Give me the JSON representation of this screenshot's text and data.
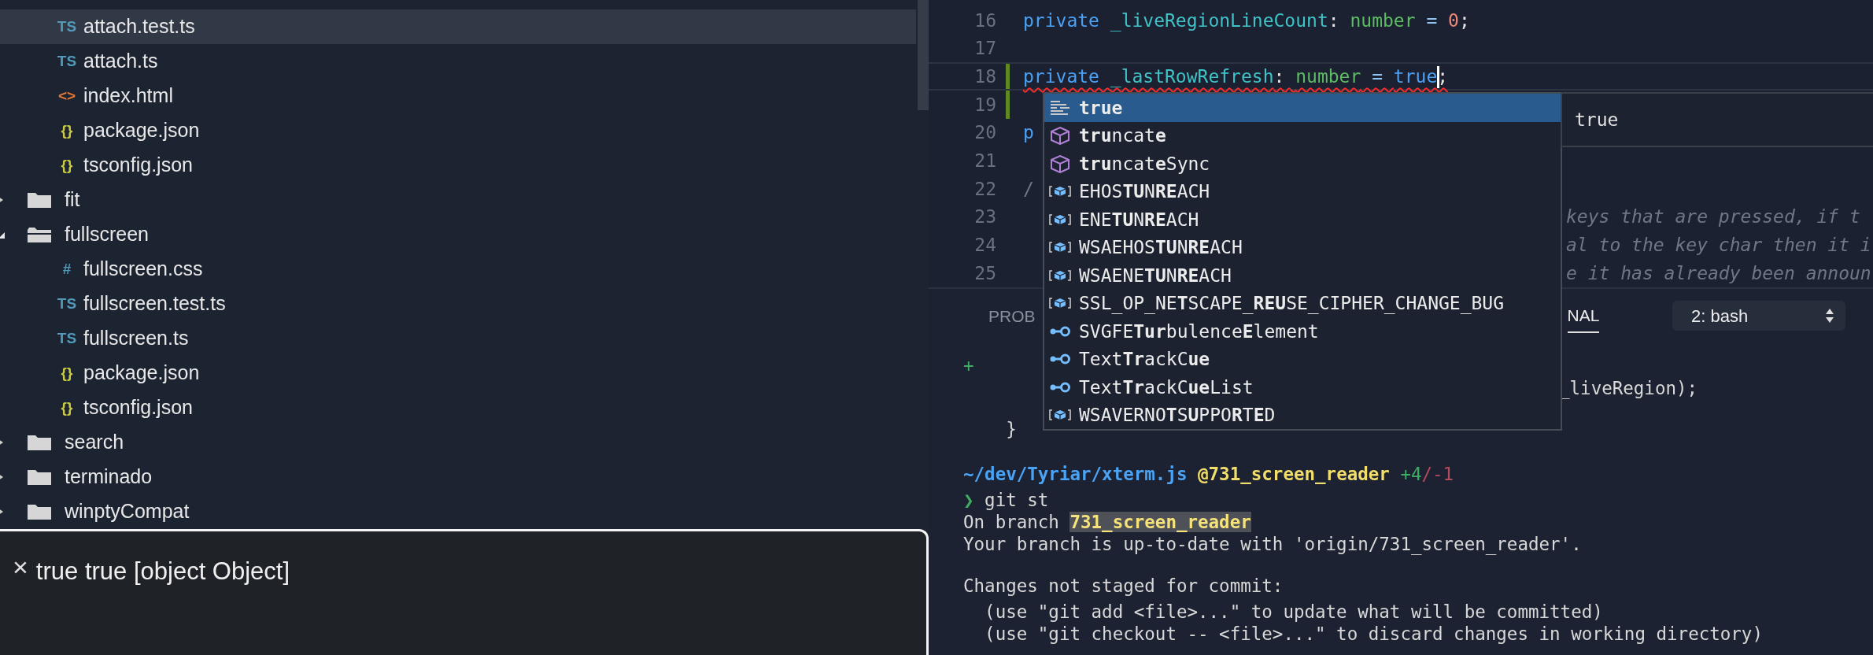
{
  "explorer": {
    "tree": [
      {
        "children": [
          {
            "label": "attach.test.ts",
            "icon": "TS",
            "color": "#519aba",
            "selected": true
          },
          {
            "label": "attach.ts",
            "icon": "TS",
            "color": "#519aba",
            "selected": false
          },
          {
            "label": "index.html",
            "icon": "<>",
            "color": "#e37933",
            "selected": false
          },
          {
            "label": "package.json",
            "icon": "{}",
            "color": "#cbcb41",
            "selected": false
          },
          {
            "label": "tsconfig.json",
            "icon": "{}",
            "color": "#cbcb41",
            "selected": false
          }
        ]
      },
      {
        "label": "fit",
        "expanded": false,
        "selected": false
      },
      {
        "label": "fullscreen",
        "expanded": true,
        "selected": false,
        "children": [
          {
            "label": "fullscreen.css",
            "icon": "#",
            "color": "#519aba",
            "selected": false
          },
          {
            "label": "fullscreen.test.ts",
            "icon": "TS",
            "color": "#519aba",
            "selected": false
          },
          {
            "label": "fullscreen.ts",
            "icon": "TS",
            "color": "#519aba",
            "selected": false
          },
          {
            "label": "package.json",
            "icon": "{}",
            "color": "#cbcb41",
            "selected": false
          },
          {
            "label": "tsconfig.json",
            "icon": "{}",
            "color": "#cbcb41",
            "selected": false
          }
        ]
      },
      {
        "label": "search",
        "expanded": false,
        "selected": false
      },
      {
        "label": "terminado",
        "expanded": false,
        "selected": false
      },
      {
        "label": "winptyCompat",
        "expanded": false,
        "selected": false
      }
    ]
  },
  "notification": {
    "close": "×",
    "message": "true true [object Object]"
  },
  "editor": {
    "lines": [
      {
        "number": "16",
        "modified": false,
        "current": false,
        "error": false,
        "tokens": [
          {
            "text": "private ",
            "kind": "keyword"
          },
          {
            "text": "_liveRegionLineCount",
            "kind": "property"
          },
          {
            "text": ": ",
            "kind": "punct"
          },
          {
            "text": "number",
            "kind": "type"
          },
          {
            "text": " = ",
            "kind": "operator"
          },
          {
            "text": "0",
            "kind": "number"
          },
          {
            "text": ";",
            "kind": "punct"
          }
        ]
      },
      {
        "number": "17",
        "modified": false,
        "current": false,
        "error": false
      },
      {
        "number": "18",
        "modified": true,
        "current": true,
        "error": true,
        "tokens": [
          {
            "text": "private ",
            "kind": "keyword"
          },
          {
            "text": "_lastRowRefresh",
            "kind": "property"
          },
          {
            "text": ": ",
            "kind": "punct"
          },
          {
            "text": "number",
            "kind": "type"
          },
          {
            "text": " = ",
            "kind": "operator"
          },
          {
            "text": "true",
            "kind": "keyword",
            "caret": true
          },
          {
            "text": ";",
            "kind": "punct"
          }
        ]
      },
      {
        "number": "19",
        "modified": true,
        "current": false,
        "error": false
      },
      {
        "number": "20",
        "modified": false,
        "current": false,
        "error": false,
        "tokens": [
          {
            "text": "p",
            "kind": "keyword"
          }
        ]
      },
      {
        "number": "21",
        "modified": false,
        "current": false,
        "error": false
      },
      {
        "number": "22",
        "modified": false,
        "current": false,
        "error": false,
        "tokens": [
          {
            "text": "/",
            "kind": "comment"
          }
        ]
      },
      {
        "number": "23",
        "modified": false,
        "current": false,
        "error": false,
        "tail": "keys that are pressed, if t"
      },
      {
        "number": "24",
        "modified": false,
        "current": false,
        "error": false,
        "tail": "al to the key char then it i"
      },
      {
        "number": "25",
        "modified": false,
        "current": false,
        "error": false,
        "tail": "e it has already been announ"
      }
    ],
    "suggestions": [
      {
        "label": "**true**",
        "kind": "keyword",
        "selected": true
      },
      {
        "label": "**tru**ncat**e**",
        "kind": "module",
        "selected": false
      },
      {
        "label": "**tru**ncat**e**Sync",
        "kind": "module",
        "selected": false
      },
      {
        "label": "EHOS**TU**N**RE**ACH",
        "kind": "constant",
        "selected": false
      },
      {
        "label": "ENE**TU**N**RE**ACH",
        "kind": "constant",
        "selected": false
      },
      {
        "label": "WSAEHOS**TU**N**RE**ACH",
        "kind": "constant",
        "selected": false
      },
      {
        "label": "WSAENE**TU**N**RE**ACH",
        "kind": "constant",
        "selected": false
      },
      {
        "label": "SSL_OP_NE**T**SCAPE_**REU**SE_CIPHER_CHANGE_BUG",
        "kind": "constant",
        "selected": false
      },
      {
        "label": "SVGFE**Tur**bulence**E**lement",
        "kind": "interface",
        "selected": false
      },
      {
        "label": "Text**Tr**ackC**ue**",
        "kind": "interface",
        "selected": false
      },
      {
        "label": "Text**Tr**ackC**ue**List",
        "kind": "interface",
        "selected": false
      },
      {
        "label": "WSAVERNO**T**S**U**PPO**R**T**E**D",
        "kind": "constant",
        "selected": false
      }
    ],
    "details": "true"
  },
  "panel": {
    "tabs": [
      {
        "label": "PROB",
        "selected": false
      },
      {
        "label": "NAL",
        "selected": true
      }
    ],
    "terminal_select": "2: bash",
    "lines": [
      {
        "space_before": false,
        "tokens": [
          {
            "text": "+",
            "kind": "added"
          }
        ]
      },
      {
        "space_before": false,
        "tail": "_liveRegion);"
      },
      {
        "space_before": true,
        "tokens": [
          {
            "text": "    }",
            "kind": "plain"
          }
        ]
      },
      {
        "space_before": true,
        "tokens": [
          {
            "text": "~/dev/Tyriar/xterm.js",
            "kind": "path"
          },
          {
            "text": " @731_screen_reader",
            "kind": "branch"
          },
          {
            "text": " +4",
            "kind": "added"
          },
          {
            "text": "/-1",
            "kind": "removed"
          }
        ]
      },
      {
        "space_before": false,
        "tokens": [
          {
            "text": "❯",
            "kind": "prompt"
          },
          {
            "text": " git st",
            "kind": "plain"
          }
        ]
      },
      {
        "space_before": false,
        "tokens": [
          {
            "text": "On branch ",
            "kind": "plain"
          },
          {
            "text": "731_screen_reader",
            "kind": "highlight"
          }
        ]
      },
      {
        "space_before": false,
        "tokens": [
          {
            "text": "Your branch is up-to-date with 'origin/731_screen_reader'.",
            "kind": "plain"
          }
        ]
      },
      {
        "space_before": true,
        "tokens": [
          {
            "text": "Changes not staged for commit:",
            "kind": "plain"
          }
        ]
      },
      {
        "space_before": false,
        "tokens": [
          {
            "text": "  (use \"git add <file>...\" to update what will be committed)",
            "kind": "plain"
          }
        ]
      },
      {
        "space_before": false,
        "tokens": [
          {
            "text": "  (use \"git checkout -- <file>...\" to discard changes in working directory)",
            "kind": "plain"
          }
        ]
      }
    ]
  }
}
